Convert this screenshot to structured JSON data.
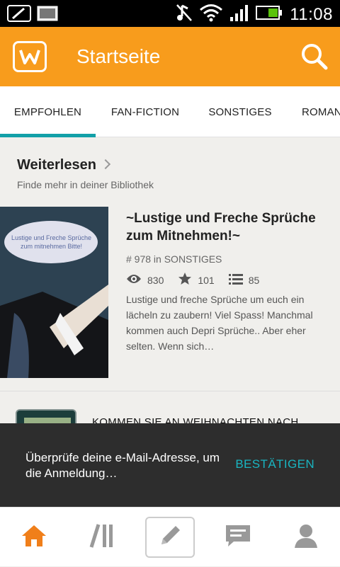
{
  "status_bar": {
    "time": "11:08"
  },
  "app_bar": {
    "title": "Startseite"
  },
  "tabs": [
    {
      "label": "EMPFOHLEN",
      "active": true
    },
    {
      "label": "FAN-FICTION",
      "active": false
    },
    {
      "label": "SONSTIGES",
      "active": false
    },
    {
      "label": "ROMAN",
      "active": false
    }
  ],
  "section": {
    "title": "Weiterlesen",
    "subtitle": "Finde mehr in deiner Bibliothek"
  },
  "story": {
    "title": "~Lustige und Freche Sprüche zum Mitnehmen!~",
    "rank": "# 978 in SONSTIGES",
    "views": "830",
    "votes": "101",
    "parts": "85",
    "description": "Lustige und freche Sprüche um euch ein lächeln zu zaubern! Viel Spass! Manchmal kommen auch Depri Sprüche.. Aber eher selten.  Wenn sich…",
    "cover_text": "Lustige und Freche Sprüche zum mitnehmen Bitte!"
  },
  "next_story": {
    "title": "KOMMEN SIE AN WEIHNACHTEN NACH"
  },
  "snackbar": {
    "message": "Überprüfe deine e-Mail-Adresse, um die Anmeldung…",
    "action": "BESTÄTIGEN"
  },
  "colors": {
    "brand_orange": "#f89c1c",
    "accent_teal": "#12a0a8",
    "nav_active": "#f07f1a"
  },
  "bottom_nav": [
    "home-icon",
    "library-icon",
    "write-icon",
    "messages-icon",
    "profile-icon"
  ]
}
